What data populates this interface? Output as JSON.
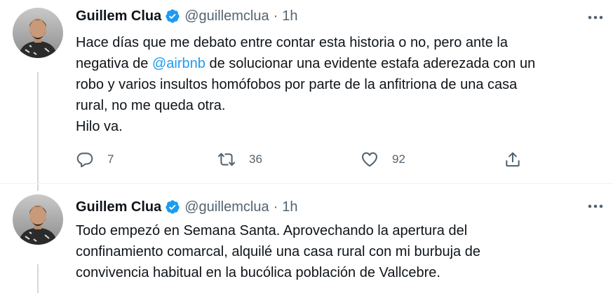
{
  "tweets": [
    {
      "author_name": "Guillem Clua",
      "handle": "@guillemclua",
      "separator": "·",
      "time": "1h",
      "lines": [
        {
          "before": "Hace días que me debato entre contar esta historia o no, pero ante la",
          "mention": "",
          "after": ""
        },
        {
          "before": "negativa de ",
          "mention": "@airbnb",
          "after": " de solucionar una evidente estafa aderezada con un"
        },
        {
          "before": "robo y varios insultos homófobos por parte de la anfitriona de una casa",
          "mention": "",
          "after": ""
        },
        {
          "before": "rural, no me queda otra.",
          "mention": "",
          "after": ""
        },
        {
          "before": "Hilo va.",
          "mention": "",
          "after": ""
        }
      ],
      "reply_count": "7",
      "retweet_count": "36",
      "like_count": "92"
    },
    {
      "author_name": "Guillem Clua",
      "handle": "@guillemclua",
      "separator": "·",
      "time": "1h",
      "lines": [
        {
          "before": "Todo empezó en Semana Santa. Aprovechando la apertura del",
          "mention": "",
          "after": ""
        },
        {
          "before": "confinamiento comarcal, alquilé una casa rural con mi burbuja de",
          "mention": "",
          "after": ""
        },
        {
          "before": "convivencia habitual en la bucólica población de Vallcebre.",
          "mention": "",
          "after": ""
        }
      ]
    }
  ],
  "colors": {
    "accent": "#1d9bf0",
    "secondary_text": "#536471",
    "primary_text": "#0f1419"
  },
  "icons": [
    "verified-badge-icon",
    "more-options-icon",
    "reply-icon",
    "retweet-icon",
    "like-icon",
    "share-icon"
  ]
}
